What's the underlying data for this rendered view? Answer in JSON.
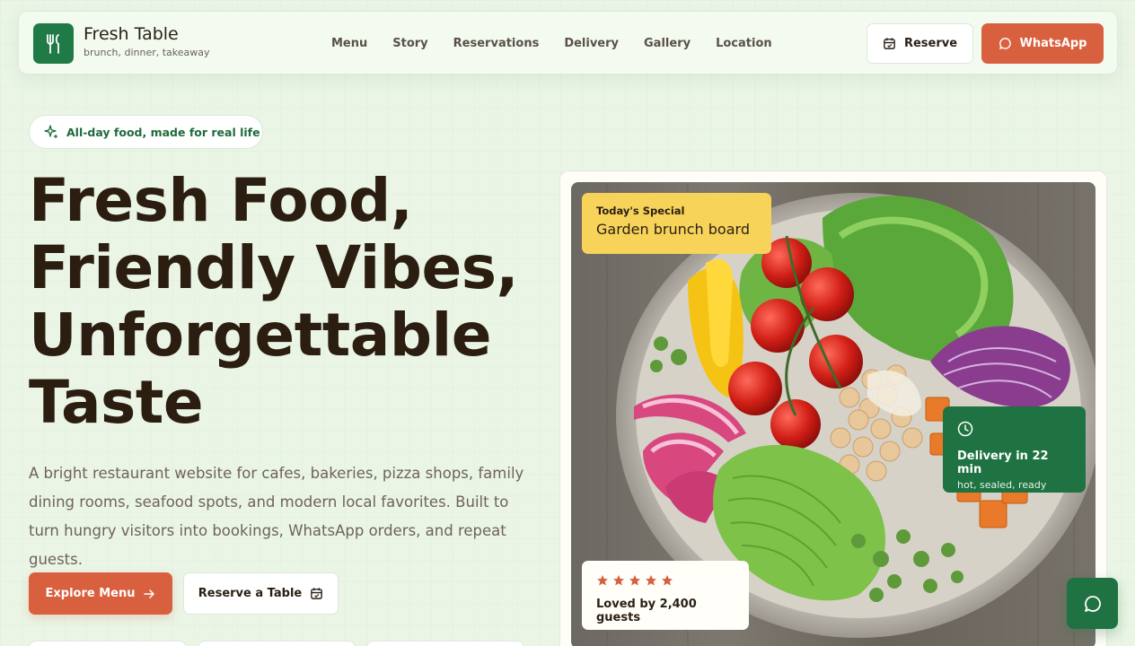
{
  "brand": {
    "name": "Fresh Table",
    "tagline": "brunch, dinner, takeaway",
    "logo_icon": "utensils-icon"
  },
  "nav": {
    "links": [
      "Menu",
      "Story",
      "Reservations",
      "Delivery",
      "Gallery",
      "Location"
    ],
    "reserve_label": "Reserve",
    "whatsapp_label": "WhatsApp"
  },
  "hero": {
    "badge": "All-day food, made for real life",
    "headline": [
      "Fresh Food,",
      "Friendly Vibes,",
      "Unforgettable",
      "Taste"
    ],
    "subtext": "A bright restaurant website for cafes, bakeries, pizza shops, family dining rooms, seafood spots, and modern local favorites. Built to turn hungry visitors into bookings, WhatsApp orders, and repeat guests.",
    "explore_label": "Explore Menu",
    "table_label": "Reserve a Table"
  },
  "special": {
    "label": "Today's Special",
    "name": "Garden brunch board"
  },
  "delivery": {
    "title": "Delivery in 22 min",
    "sub": "hot, sealed, ready"
  },
  "reviews": {
    "stars": 5,
    "text": "Loved by 2,400 guests"
  },
  "colors": {
    "primary_green": "#1f7241",
    "accent_orange": "#d9603f",
    "special_yellow": "#f7d35a",
    "background": "#eaf5e6"
  }
}
